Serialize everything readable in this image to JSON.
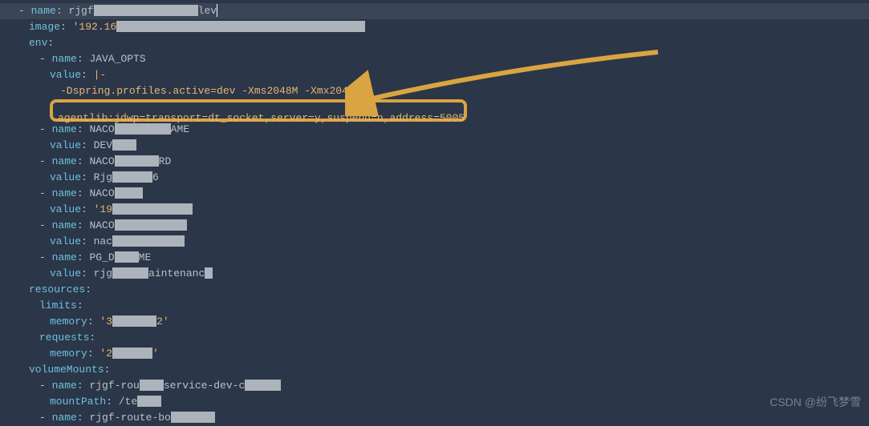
{
  "lines": {
    "l1_prefix": "- ",
    "l1_key": "name",
    "l1_val_a": "rjgf",
    "l1_val_b": "lev",
    "l2_key": "image",
    "l2_val": "'192.16",
    "l3_key": "env",
    "l4_key": "name",
    "l4_val": "JAVA_OPTS",
    "l5_key": "value",
    "l5_val": "|-",
    "l6_text": "-Dspring.profiles.active=dev -Xms2048M -Xmx2048M",
    "hl_text": "-agentlib:jdwp=transport=dt_socket,server=y,suspend=n,address=5005",
    "l8_key": "name",
    "l8_val_a": "NACO",
    "l8_val_b": "AME",
    "l9_key": "value",
    "l9_val": "DEV",
    "l10_key": "name",
    "l10_val_a": "NACO",
    "l10_val_b": "RD",
    "l11_key": "value",
    "l11_val_a": "Rjg",
    "l11_val_b": "6",
    "l12_key": "name",
    "l12_val": "NACO",
    "l13_key": "value",
    "l13_val": "'19",
    "l14_key": "name",
    "l14_val": "NACO",
    "l15_key": "value",
    "l15_val": "nac",
    "l16_key": "name",
    "l16_val_a": "PG_D",
    "l16_val_b": "ME",
    "l17_key": "value",
    "l17_val_a": "rjg",
    "l17_val_b": "aintenanc",
    "l18_key": "resources",
    "l19_key": "limits",
    "l20_key": "memory",
    "l20_val_a": "'3",
    "l20_val_b": "2'",
    "l21_key": "requests",
    "l22_key": "memory",
    "l22_val_a": "'2",
    "l22_val_b": "'",
    "l23_key": "volumeMounts",
    "l24_key": "name",
    "l24_val_a": "rjgf-rou",
    "l24_val_b": "service-dev-c",
    "l25_key": "mountPath",
    "l25_val": "/te",
    "l26_key": "name",
    "l26_val": "rjgf-route-bo"
  },
  "watermark": "CSDN @纷飞梦雪",
  "annotation": {
    "arrow_color": "#d9a441"
  }
}
